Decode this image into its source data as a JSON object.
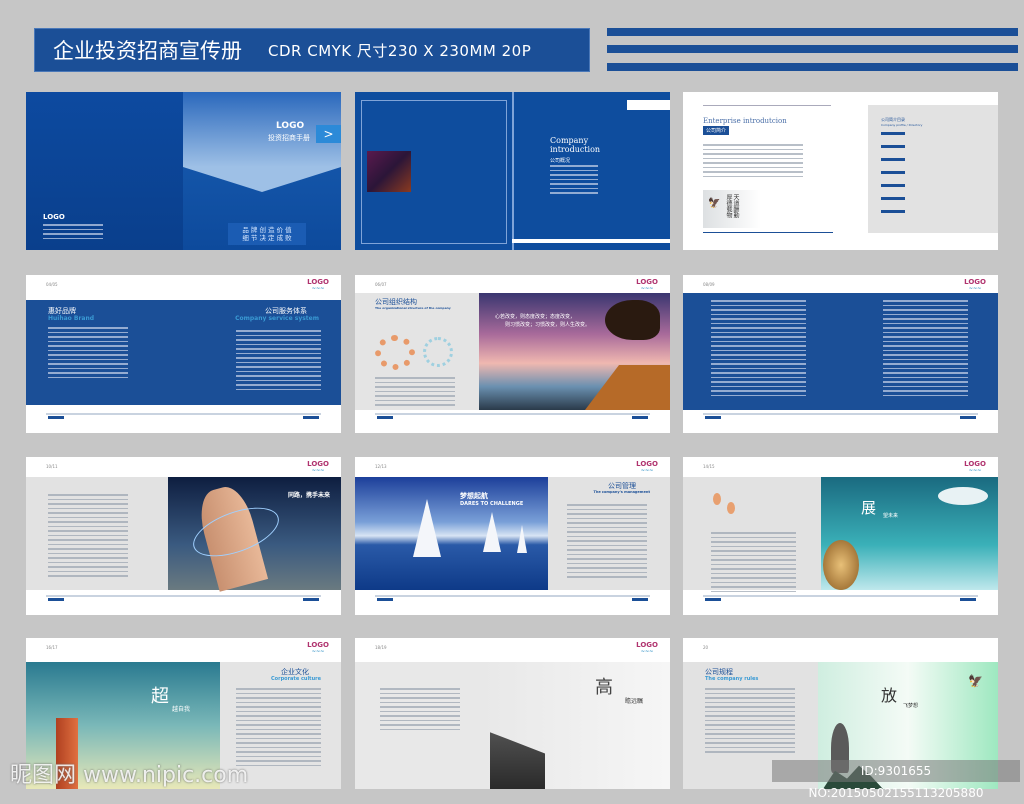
{
  "header": {
    "title": "企业投资招商宣传册",
    "spec": "CDR  CMYK  尺寸230 X 230MM  20P"
  },
  "colors": {
    "brand": "#1b4f97",
    "accent": "#3a9ad4",
    "background": "#c6c6c6"
  },
  "logo": {
    "text": "LOGO"
  },
  "spreads": [
    {
      "name": "cover",
      "logo": "LOGO",
      "subtitle": "投资招商手册",
      "slogan1": "品 牌 创 造 价 值",
      "slogan2": "细 节 决 定 成 败",
      "back_logo": "LOGO"
    },
    {
      "name": "company-introduction",
      "title1": "Company",
      "title2": "introduction",
      "cn": "公司概况"
    },
    {
      "name": "enterprise-introduction",
      "title": "Enterprise introdutcion",
      "cn": "公司简介",
      "toc": "公司简介目录",
      "toc_en": "Company profile / Directory"
    },
    {
      "name": "brand-service",
      "page": "04/05",
      "left_cn": "惠好品牌",
      "left_en": "Huihao Brand",
      "right_cn": "公司服务体系",
      "right_en": "Company service system"
    },
    {
      "name": "organization",
      "page": "06/07",
      "cn": "公司组织结构",
      "en": "The organizational structure of the company",
      "quote1": "心若改变，则态度改变；态度改变，",
      "quote2": "则习惯改变；习惯改变，则人生改变。"
    },
    {
      "name": "text-spread",
      "page": "08/09"
    },
    {
      "name": "cooperation",
      "page": "10/11",
      "slogan": "同路，携手未来"
    },
    {
      "name": "management",
      "page": "12/13",
      "slogan_cn": "梦想起航",
      "slogan_en": "DARES TO CHALLENGE",
      "cn": "公司管理",
      "en": "The company's management"
    },
    {
      "name": "outlook",
      "page": "14/15",
      "big": "展",
      "rest": "望未来"
    },
    {
      "name": "culture",
      "page": "16/17",
      "big": "超",
      "rest": "越自我",
      "cn": "企业文化",
      "en": "Corporate culture"
    },
    {
      "name": "vision",
      "page": "18/19",
      "big": "高",
      "rest": "瞻远瞩"
    },
    {
      "name": "rules",
      "page": "20",
      "cn": "公司规程",
      "en": "The company rules",
      "big": "放",
      "rest": "飞梦想"
    }
  ],
  "watermark": {
    "site": "昵图网 www.nipic.com",
    "id": "ID:9301655 NO:20150502155113205880"
  }
}
